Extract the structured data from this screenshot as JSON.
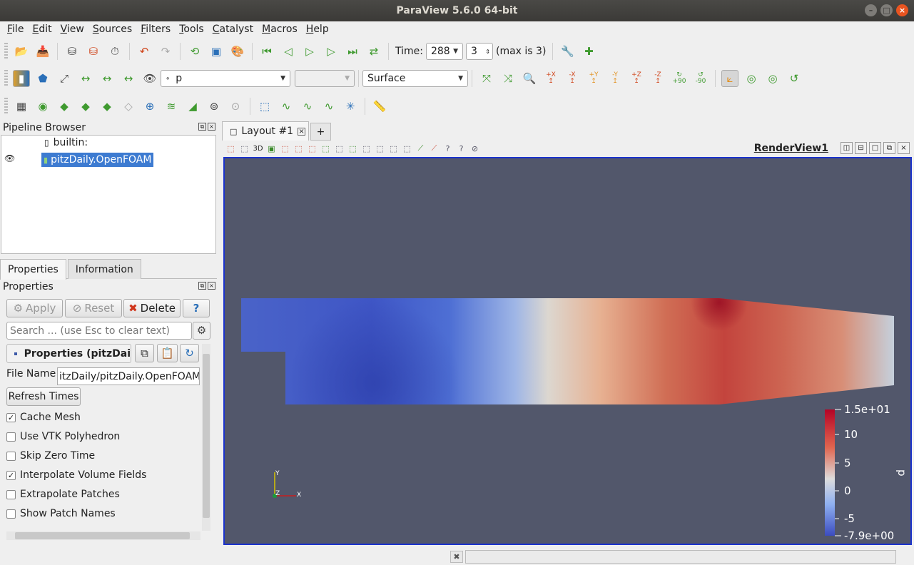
{
  "window": {
    "title": "ParaView 5.6.0 64-bit"
  },
  "menu": [
    "File",
    "Edit",
    "View",
    "Sources",
    "Filters",
    "Tools",
    "Catalyst",
    "Macros",
    "Help"
  ],
  "time_toolbar": {
    "label": "Time:",
    "time_value": "288",
    "index_value": "3",
    "max_text": "(max is 3)"
  },
  "display_toolbar": {
    "array_value": "p",
    "component_value": "",
    "representation_value": "Surface"
  },
  "camera_labels": {
    "x_plus": "+X",
    "x_minus": "-X",
    "y_plus": "+Y",
    "y_minus": "-Y",
    "z_plus": "+Z",
    "z_minus": "-Z",
    "rot_plus": "+90",
    "rot_minus": "-90"
  },
  "pipeline": {
    "title": "Pipeline Browser",
    "items": [
      {
        "label": "builtin:"
      },
      {
        "label": "pitzDaily.OpenFOAM",
        "selected": true
      }
    ]
  },
  "panel_tabs": [
    "Properties",
    "Information"
  ],
  "properties": {
    "title": "Properties",
    "apply": "Apply",
    "reset": "Reset",
    "delete": "Delete",
    "help": "?",
    "search_placeholder": "Search ... (use Esc to clear text)",
    "section_title": "Properties (pitzDai",
    "file_name_label": "File Name",
    "file_name_value": "itzDaily/pitzDaily.OpenFOAM",
    "refresh_times": "Refresh Times",
    "checkboxes": [
      {
        "label": "Cache Mesh",
        "checked": true
      },
      {
        "label": "Use VTK Polyhedron",
        "checked": false
      },
      {
        "label": "Skip Zero Time",
        "checked": false
      },
      {
        "label": "Interpolate Volume Fields",
        "checked": true
      },
      {
        "label": "Extrapolate Patches",
        "checked": false
      },
      {
        "label": "Show Patch Names",
        "checked": false
      }
    ]
  },
  "layout": {
    "tab_label": "Layout #1",
    "add_tab": "+",
    "view_mode": "3D",
    "view_name": "RenderView1"
  },
  "render": {
    "background": "#52576b",
    "field": "p",
    "colorbar": {
      "max": "1.5e+01",
      "min": "-7.9e+00",
      "ticks": [
        "10",
        "5",
        "0",
        "-5"
      ],
      "title": "p"
    },
    "axes": {
      "x": "X",
      "y": "Y",
      "z": "Z"
    }
  }
}
